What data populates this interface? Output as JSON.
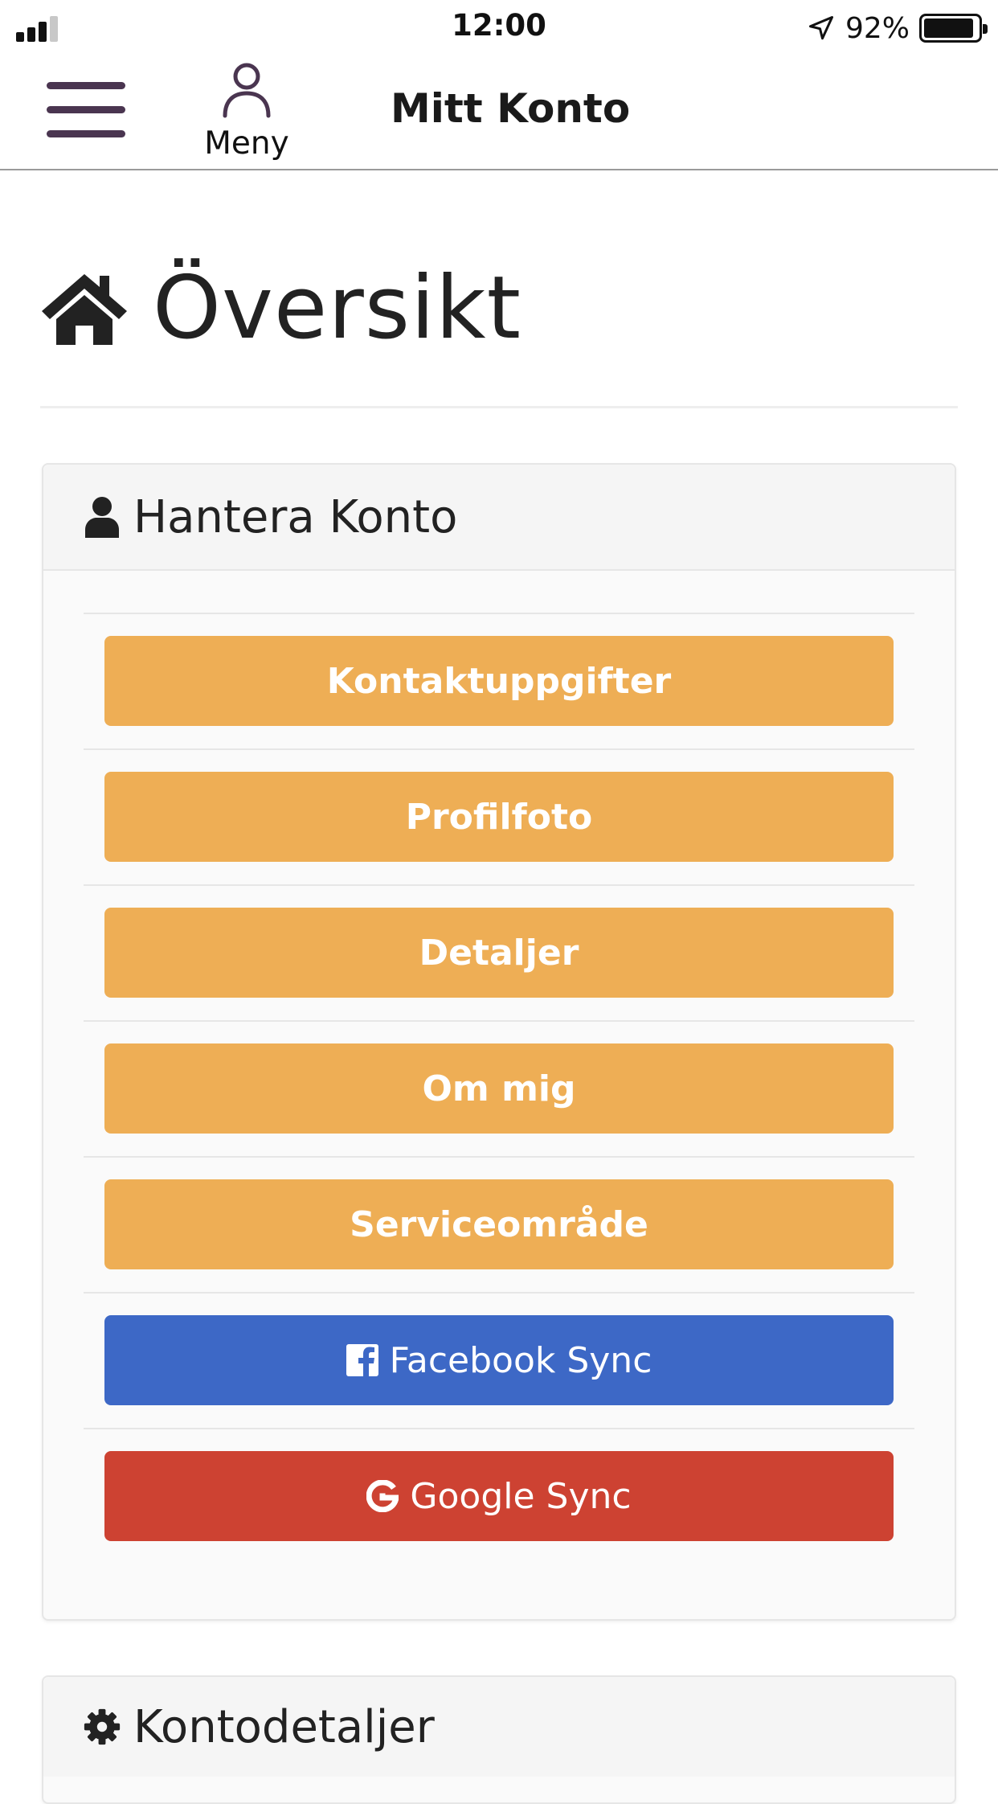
{
  "status_bar": {
    "time": "12:00",
    "battery_percent": "92%",
    "battery_level": 0.92
  },
  "navbar": {
    "menu_label": "Meny",
    "title": "Mitt Konto"
  },
  "page": {
    "title": "Översikt",
    "icon": "home-icon"
  },
  "panels": {
    "manage_account": {
      "title": "Hantera Konto",
      "icon": "user-icon",
      "buttons": [
        {
          "label": "Kontaktuppgifter",
          "color": "#eeae55"
        },
        {
          "label": "Profilfoto",
          "color": "#eeae55"
        },
        {
          "label": "Detaljer",
          "color": "#eeae55"
        },
        {
          "label": "Om mig",
          "color": "#eeae55"
        },
        {
          "label": "Serviceområde",
          "color": "#eeae55"
        },
        {
          "label": "Facebook Sync",
          "color": "#3d68c6",
          "icon": "facebook-icon"
        },
        {
          "label": "Google Sync",
          "color": "#cd4232",
          "icon": "google-icon"
        }
      ]
    },
    "account_details": {
      "title": "Kontodetaljer",
      "icon": "gear-icon"
    }
  }
}
